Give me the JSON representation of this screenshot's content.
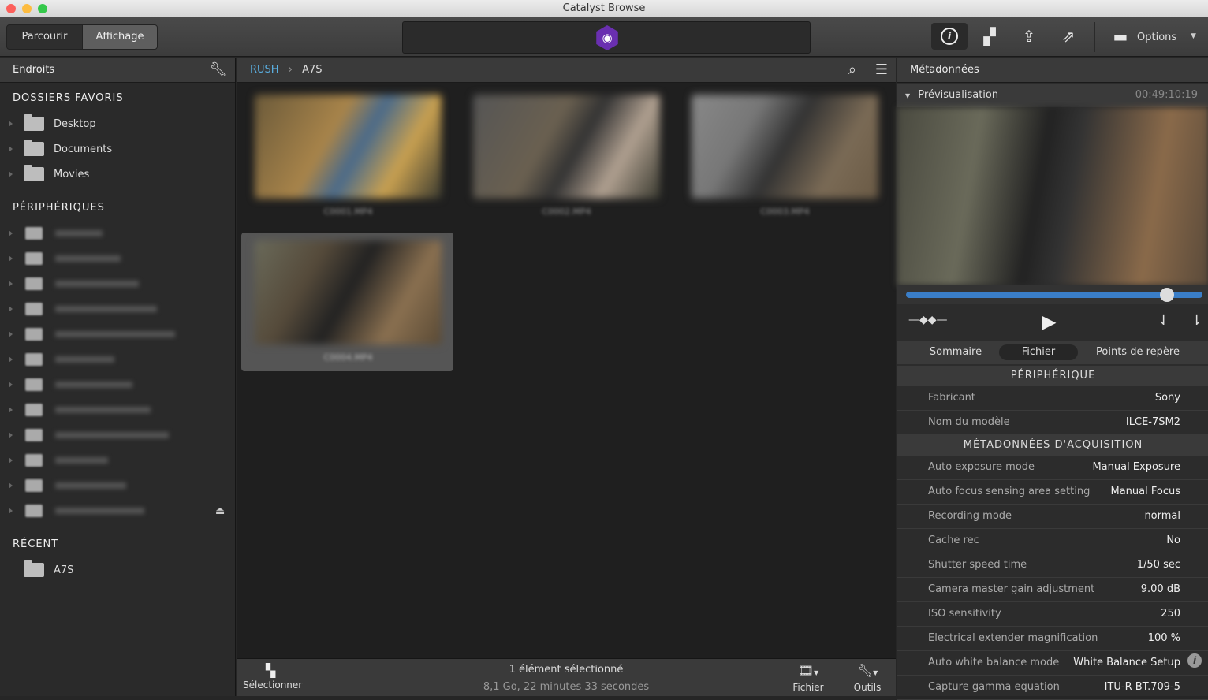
{
  "window": {
    "title": "Catalyst Browse"
  },
  "toolbar": {
    "tabs": [
      "Parcourir",
      "Affichage"
    ],
    "options_label": "Options",
    "icons": [
      "info-icon",
      "windows-icon",
      "upload-icon",
      "share-icon",
      "toolbox-icon"
    ]
  },
  "sidebar": {
    "title": "Endroits",
    "favorites_title": "DOSSIERS FAVORIS",
    "favorites": [
      "Desktop",
      "Documents",
      "Movies"
    ],
    "devices_title": "PÉRIPHÉRIQUES",
    "recent_title": "RÉCENT",
    "recent": [
      "A7S"
    ]
  },
  "browser": {
    "breadcrumb": [
      "RUSH",
      "A7S"
    ],
    "clips": [
      "C0001.MP4",
      "C0002.MP4",
      "C0003.MP4",
      "C0004.MP4"
    ],
    "selected_index": 3,
    "status": "1 élément sélectionné",
    "summary": "8,1 Go, 22 minutes 33 secondes",
    "select_label": "Sélectionner",
    "file_label": "Fichier",
    "tools_label": "Outils"
  },
  "metadata": {
    "title": "Métadonnées",
    "preview_label": "Prévisualisation",
    "timecode": "00:49:10:19",
    "playhead_percent": 88,
    "tabs": [
      "Sommaire",
      "Fichier",
      "Points de repère"
    ],
    "active_tab": "Fichier",
    "sections": [
      {
        "title": "PÉRIPHÉRIQUE",
        "rows": [
          [
            "Fabricant",
            "Sony"
          ],
          [
            "Nom du modèle",
            "ILCE-7SM2"
          ]
        ]
      },
      {
        "title": "MÉTADONNÉES D'ACQUISITION",
        "rows": [
          [
            "Auto exposure mode",
            "Manual Exposure"
          ],
          [
            "Auto focus sensing area setting",
            "Manual Focus"
          ],
          [
            "Recording mode",
            "normal"
          ],
          [
            "Cache rec",
            "No"
          ],
          [
            "Shutter speed time",
            "1/50 sec"
          ],
          [
            "Camera master gain adjustment",
            "9.00 dB"
          ],
          [
            "ISO sensitivity",
            "250"
          ],
          [
            "Electrical extender magnification",
            "100 %"
          ],
          [
            "Auto white balance mode",
            "White Balance Setup"
          ],
          [
            "Capture gamma equation",
            "ITU-R BT.709-5"
          ]
        ]
      }
    ]
  }
}
